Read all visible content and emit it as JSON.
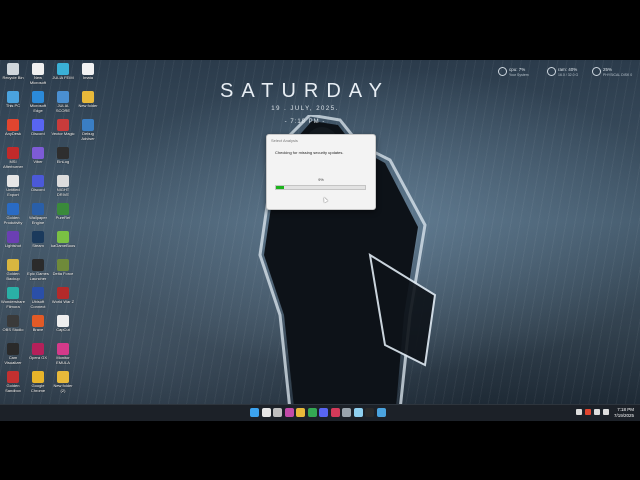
{
  "desktop_icons": [
    {
      "label": "Recycle Bin",
      "color": "#cfd6dc"
    },
    {
      "label": "This PC",
      "color": "#4aa3df"
    },
    {
      "label": "AnyDesk",
      "color": "#e0452f"
    },
    {
      "label": "MSI Afterburner",
      "color": "#c22a2a"
    },
    {
      "label": "Untitled Export",
      "color": "#e6e6e6"
    },
    {
      "label": "Golden Produtivity",
      "color": "#2a6bc4"
    },
    {
      "label": "Lightshot",
      "color": "#6b3fb3"
    },
    {
      "label": "Golden Backup",
      "color": "#d8b640"
    },
    {
      "label": "Wondershare Filmora",
      "color": "#2ab0a6"
    },
    {
      "label": "OBS Studio",
      "color": "#3a3a3a"
    },
    {
      "label": "Cam Visualizer",
      "color": "#2a2a2a"
    },
    {
      "label": "Golden Sandbox",
      "color": "#c33030"
    },
    {
      "label": "New Microsoft",
      "color": "#f0f0f0"
    },
    {
      "label": "Microsoft Edge",
      "color": "#2b8ad9"
    },
    {
      "label": "Discord",
      "color": "#5865f2"
    },
    {
      "label": "Viber",
      "color": "#7d5bd6"
    },
    {
      "label": "Discord",
      "color": "#4b59d8"
    },
    {
      "label": "Wallpaper Engine",
      "color": "#2a5fa8"
    },
    {
      "label": "Steam",
      "color": "#1b3a5c"
    },
    {
      "label": "Epic Games Launcher",
      "color": "#2b2b2b"
    },
    {
      "label": "Ubisoft Connect",
      "color": "#2a4fa8"
    },
    {
      "label": "Brave",
      "color": "#e25a26"
    },
    {
      "label": "Opera GX",
      "color": "#b5205a"
    },
    {
      "label": "Google Chrome",
      "color": "#e8b42a"
    },
    {
      "label": "JULIA FEIM",
      "color": "#3ab0d6"
    },
    {
      "label": "JULIA SCORE",
      "color": "#4a8fd1"
    },
    {
      "label": "Vector Magic",
      "color": "#c83b3b"
    },
    {
      "label": "EinLog",
      "color": "#2e2e2e"
    },
    {
      "label": "NIGHT DRIVE",
      "color": "#dcdcdc"
    },
    {
      "label": "PureRef",
      "color": "#3a8a3a"
    },
    {
      "label": "kaGameBooster",
      "color": "#7ac043"
    },
    {
      "label": "Delta Force",
      "color": "#6f8a3a"
    },
    {
      "label": "World War Z",
      "color": "#b32a2a"
    },
    {
      "label": "CapCut",
      "color": "#eeeeee"
    },
    {
      "label": "Monitor EMULA",
      "color": "#d43a8a"
    },
    {
      "label": "New folder (2)",
      "color": "#e8b93a"
    },
    {
      "label": "Imata",
      "color": "#f2f2f2"
    },
    {
      "label": "New folder",
      "color": "#e8b93a"
    },
    {
      "label": "Debug Adviser",
      "color": "#3a7ec4"
    }
  ],
  "clock": {
    "day": "SATURDAY",
    "date": "19 . JULY, 2025.",
    "time": "- 7:18 PM -"
  },
  "stats": [
    {
      "value": "cpu: 7%",
      "sub": "Your System"
    },
    {
      "value": "ram: 40%",
      "sub": "16.0 / 32.0 G"
    },
    {
      "value": "25%",
      "sub": "PHYSICAL DISK 0"
    }
  ],
  "dialog": {
    "title": "Select Analysis",
    "message": "Checking for missing security updates.",
    "percent_label": "9%",
    "progress": 0.09,
    "progress_color": "#1db31d"
  },
  "taskbar": {
    "time": "7:18 PM",
    "date": "7/19/2025",
    "apps": [
      {
        "name": "start-icon",
        "color": "#3ca3ef"
      },
      {
        "name": "search-icon",
        "color": "#e6e6e6"
      },
      {
        "name": "task-view-icon",
        "color": "#bfbfbf"
      },
      {
        "name": "widgets-icon",
        "color": "#c24aa8"
      },
      {
        "name": "file-explorer-icon",
        "color": "#e8b93a"
      },
      {
        "name": "chrome-icon",
        "color": "#34a853"
      },
      {
        "name": "discord-icon",
        "color": "#5865f2"
      },
      {
        "name": "opera-gx-icon",
        "color": "#d43a5a"
      },
      {
        "name": "settings-icon",
        "color": "#9aa4ad"
      },
      {
        "name": "notepad-icon",
        "color": "#8fd0f0"
      },
      {
        "name": "terminal-icon",
        "color": "#2a2a2a"
      },
      {
        "name": "store-icon",
        "color": "#4aa3df"
      }
    ],
    "tray": [
      {
        "name": "chevron-up-icon",
        "color": "#dddddd"
      },
      {
        "name": "shield-icon",
        "color": "#e0452f"
      },
      {
        "name": "network-icon",
        "color": "#dddddd"
      },
      {
        "name": "volume-icon",
        "color": "#dddddd"
      }
    ]
  }
}
